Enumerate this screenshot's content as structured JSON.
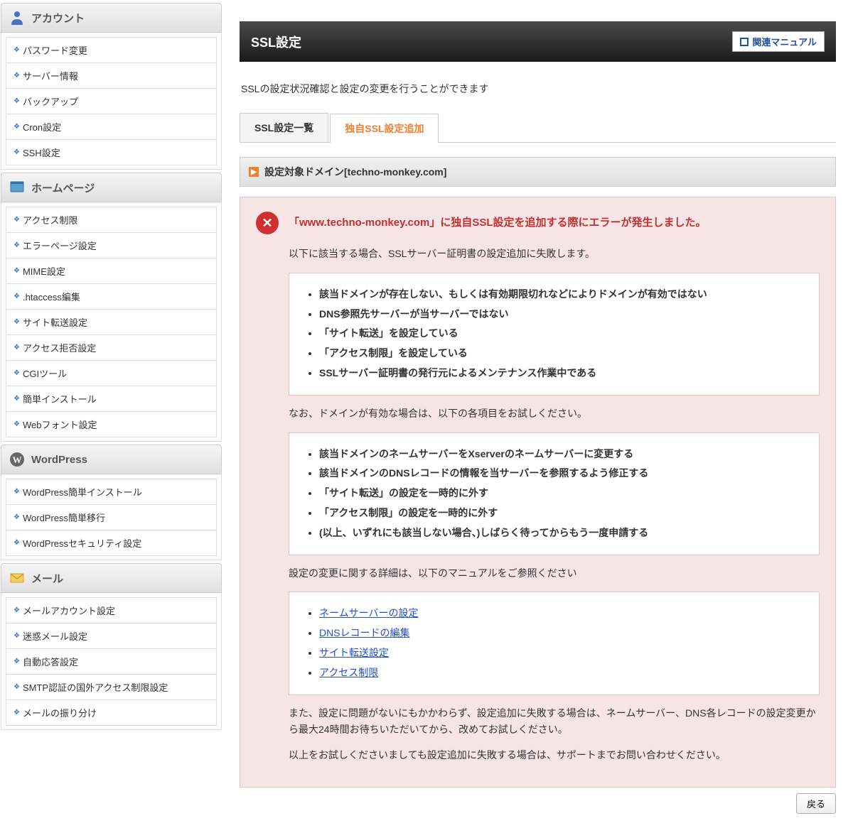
{
  "sidebar": {
    "sections": [
      {
        "title": "アカウント",
        "icon": "person",
        "items": [
          "パスワード変更",
          "サーバー情報",
          "バックアップ",
          "Cron設定",
          "SSH設定"
        ]
      },
      {
        "title": "ホームページ",
        "icon": "page",
        "items": [
          "アクセス制限",
          "エラーページ設定",
          "MIME設定",
          ".htaccess編集",
          "サイト転送設定",
          "アクセス拒否設定",
          "CGIツール",
          "簡単インストール",
          "Webフォント設定"
        ]
      },
      {
        "title": "WordPress",
        "icon": "wp",
        "items": [
          "WordPress簡単インストール",
          "WordPress簡単移行",
          "WordPressセキュリティ設定"
        ]
      },
      {
        "title": "メール",
        "icon": "mail",
        "items": [
          "メールアカウント設定",
          "迷惑メール設定",
          "自動応答設定",
          "SMTP認証の国外アクセス制限設定",
          "メールの振り分け"
        ]
      }
    ]
  },
  "page": {
    "title": "SSL設定",
    "manual_label": "関連マニュアル",
    "description": "SSLの設定状況確認と設定の変更を行うことができます",
    "tabs": [
      {
        "label": "SSL設定一覧",
        "active": false
      },
      {
        "label": "独自SSL設定追加",
        "active": true
      }
    ],
    "domain_label": "設定対象ドメイン[techno-monkey.com]",
    "error": {
      "title": "「www.techno-monkey.com」に独自SSL設定を追加する際にエラーが発生しました。",
      "p1": "以下に該当する場合、SSLサーバー証明書の設定追加に失敗します。",
      "reasons": [
        "該当ドメインが存在しない、もしくは有効期限切れなどによりドメインが有効ではない",
        "DNS参照先サーバーが当サーバーではない",
        "「サイト転送」を設定している",
        "「アクセス制限」を設定している",
        "SSLサーバー証明書の発行元によるメンテナンス作業中である"
      ],
      "p2": "なお、ドメインが有効な場合は、以下の各項目をお試しください。",
      "actions": [
        "該当ドメインのネームサーバーをXserverのネームサーバーに変更する",
        "該当ドメインのDNSレコードの情報を当サーバーを参照するよう修正する",
        "「サイト転送」の設定を一時的に外す",
        "「アクセス制限」の設定を一時的に外す",
        "(以上、いずれにも該当しない場合、)しばらく待ってからもう一度申請する"
      ],
      "p3": "設定の変更に関する詳細は、以下のマニュアルをご参照ください",
      "links": [
        "ネームサーバーの設定",
        "DNSレコードの編集",
        "サイト転送設定",
        "アクセス制限"
      ],
      "p4": "また、設定に問題がないにもかかわらず、設定追加に失敗する場合は、ネームサーバー、DNS各レコードの設定変更から最大24時間お待ちいただいてから、改めてお試しください。",
      "p5": "以上をお試しくださいましても設定追加に失敗する場合は、サポートまでお問い合わせください。"
    },
    "back_label": "戻る"
  }
}
